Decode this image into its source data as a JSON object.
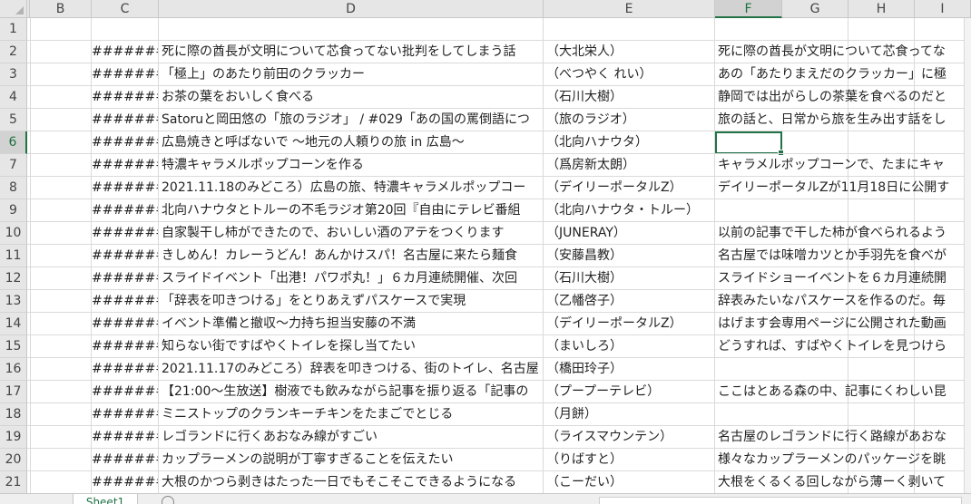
{
  "columns": [
    {
      "id": "A-hidden",
      "label": ""
    },
    {
      "id": "B",
      "label": "B"
    },
    {
      "id": "C",
      "label": "C"
    },
    {
      "id": "D",
      "label": "D"
    },
    {
      "id": "E",
      "label": "E"
    },
    {
      "id": "F",
      "label": "F"
    },
    {
      "id": "G",
      "label": "G"
    },
    {
      "id": "H",
      "label": "H"
    },
    {
      "id": "I",
      "label": "I"
    }
  ],
  "selected_column": "F",
  "selected_row": "6",
  "rows": [
    {
      "num": "1",
      "c": "",
      "d": "",
      "e": "",
      "f": ""
    },
    {
      "num": "2",
      "c": "########",
      "d": "死に際の酋長が文明について芯食ってない批判をしてしまう話",
      "e": "（大北栄人）",
      "f": "死に際の酋長が文明について芯食ってな"
    },
    {
      "num": "3",
      "c": "########",
      "d": "「極上」のあたり前田のクラッカー",
      "e": "（べつやく れい）",
      "f": "あの「あたりまえだのクラッカー」に極"
    },
    {
      "num": "4",
      "c": "########",
      "d": "お茶の葉をおいしく食べる",
      "e": "（石川大樹）",
      "f": "静岡では出がらしの茶葉を食べるのだと"
    },
    {
      "num": "5",
      "c": "########",
      "d": "Satoruと岡田悠の「旅のラジオ」 / #029「あの国の罵倒語につ",
      "e": "（旅のラジオ）",
      "f": "旅の話と、日常から旅を生み出す話をし"
    },
    {
      "num": "6",
      "c": "########",
      "d": "広島焼きと呼ばないで ～地元の人頼りの旅 in 広島～",
      "e": "（北向ハナウタ）",
      "f": ""
    },
    {
      "num": "7",
      "c": "########",
      "d": "特濃キャラメルポップコーンを作る",
      "e": "（爲房新太朗）",
      "f": "キャラメルポップコーンで、たまにキャ"
    },
    {
      "num": "8",
      "c": "########",
      "d": "2021.11.18のみどころ）広島の旅、特濃キャラメルポップコー",
      "e": "（デイリーポータルZ）",
      "f": "デイリーポータルZが11月18日に公開す"
    },
    {
      "num": "9",
      "c": "########",
      "d": "北向ハナウタとトルーの不毛ラジオ第20回『自由にテレビ番組",
      "e": "（北向ハナウタ・トルー）",
      "f": ""
    },
    {
      "num": "10",
      "c": "########",
      "d": "自家製干し柿ができたので、おいしい酒のアテをつくります",
      "e": "（JUNERAY）",
      "f": "以前の記事で干した柿が食べられるよう"
    },
    {
      "num": "11",
      "c": "########",
      "d": "きしめん！カレーうどん！あんかけスパ！名古屋に来たら麺食",
      "e": "（安藤昌教）",
      "f": "名古屋では味噌カツとか手羽先を食べが"
    },
    {
      "num": "12",
      "c": "########",
      "d": "スライドイベント「出港！パワポ丸！」６カ月連続開催、次回",
      "e": "（石川大樹）",
      "f": "スライドショーイベントを６カ月連続開"
    },
    {
      "num": "13",
      "c": "########",
      "d": "「辞表を叩きつける」をとりあえずパスケースで実現",
      "e": "（乙幡啓子）",
      "f": "辞表みたいなパスケースを作るのだ。毎"
    },
    {
      "num": "14",
      "c": "########",
      "d": "イベント準備と撤収～力持ち担当安藤の不満",
      "e": "（デイリーポータルZ）",
      "f": "はげます会専用ページに公開された動画"
    },
    {
      "num": "15",
      "c": "########",
      "d": "知らない街ですばやくトイレを探し当てたい",
      "e": "（まいしろ）",
      "f": "どうすれば、すばやくトイレを見つけら"
    },
    {
      "num": "16",
      "c": "########",
      "d": "2021.11.17のみどころ）辞表を叩きつける、街のトイレ、名古屋",
      "e": "（橋田玲子）",
      "f": ""
    },
    {
      "num": "17",
      "c": "########",
      "d": "【21:00～生放送】樹液でも飲みながら記事を振り返る「記事の",
      "e": "（プープーテレビ）",
      "f": "ここはとある森の中、記事にくわしい昆"
    },
    {
      "num": "18",
      "c": "########",
      "d": "ミニストップのクランキーチキンをたまごでとじる",
      "e": "（月餅）",
      "f": ""
    },
    {
      "num": "19",
      "c": "########",
      "d": "レゴランドに行くあおなみ線がすごい",
      "e": "（ライスマウンテン）",
      "f": "名古屋のレゴランドに行く路線があおな"
    },
    {
      "num": "20",
      "c": "########",
      "d": "カップラーメンの説明が丁寧すぎることを伝えたい",
      "e": "（りばすと）",
      "f": "様々なカップラーメンのパッケージを眺"
    },
    {
      "num": "21",
      "c": "########",
      "d": "大根のかつら剥きはたった一日でもそこそこできるようになる",
      "e": "（こーだい）",
      "f": "大根をくるくる回しながら薄ーく剥いて"
    }
  ],
  "sheet_tab": "Sheet1"
}
